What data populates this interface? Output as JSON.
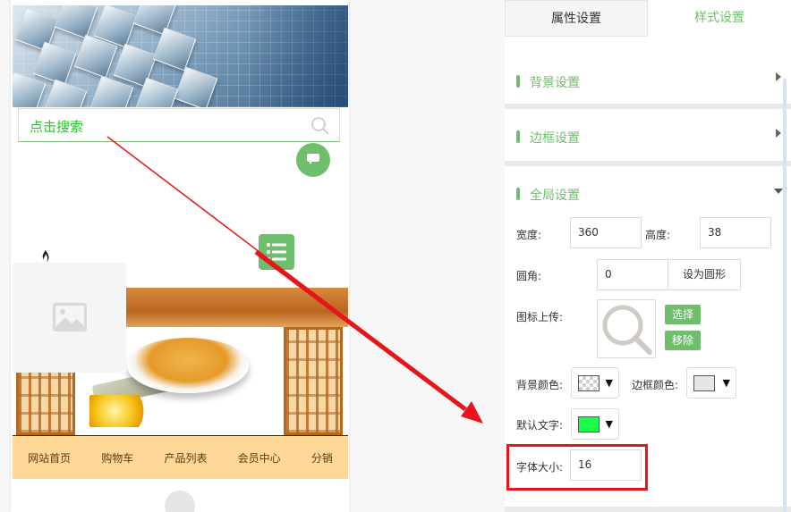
{
  "phone": {
    "search_placeholder": "点击搜索",
    "nav_items": [
      "网站首页",
      "购物车",
      "产品列表",
      "会员中心",
      "分销"
    ]
  },
  "panel": {
    "tabs": [
      "属性设置",
      "样式设置"
    ],
    "active_tab": "样式设置",
    "sections": {
      "background": "背景设置",
      "border": "边框设置",
      "global": "全局设置"
    },
    "fields": {
      "width_label": "宽度:",
      "width_value": "360",
      "height_label": "高度:",
      "height_value": "38",
      "radius_label": "圆角:",
      "radius_value": "0",
      "round_button": "设为圆形",
      "icon_upload_label": "图标上传:",
      "select_button": "选择",
      "remove_button": "移除",
      "bg_color_label": "背景颜色:",
      "border_color_label": "边框颜色:",
      "default_text_label": "默认文字:",
      "font_size_label": "字体大小:",
      "font_size_value": "16"
    }
  },
  "colors": {
    "accent": "#6fbe6b",
    "search_text": "#17d017",
    "default_text_color": "#1aff4a",
    "border_color": "#e6e6e6",
    "annotation": "#e8141b",
    "nav_bg": "#ffd797"
  },
  "icons": [
    "search-icon",
    "chat-icon",
    "menu-icon",
    "image-placeholder-icon",
    "chevron-right-icon",
    "chevron-down-icon",
    "magnifier-upload-icon"
  ]
}
